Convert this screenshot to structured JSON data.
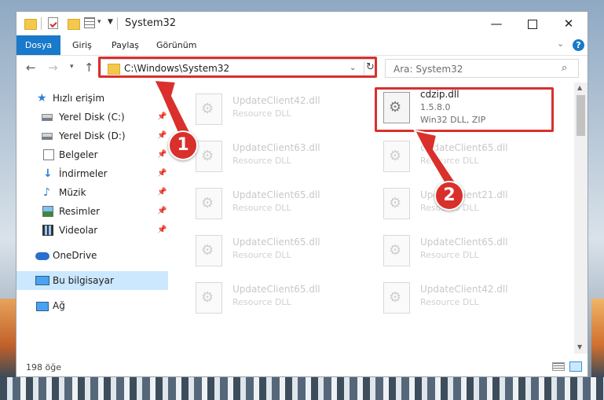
{
  "window": {
    "title": "System32",
    "minimize": "—",
    "close": "✕"
  },
  "ribbon": {
    "tabs": [
      "Dosya",
      "Giriş",
      "Paylaş",
      "Görünüm"
    ],
    "help": "?"
  },
  "navbar": {
    "address": "C:\\Windows\\System32",
    "search_placeholder": "Ara: System32"
  },
  "sidebar": {
    "items": [
      {
        "label": "Hızlı erişim",
        "icon": "star-icon",
        "pinned": false
      },
      {
        "label": "Yerel Disk (C:)",
        "icon": "drive-icon",
        "pinned": true
      },
      {
        "label": "Yerel Disk (D:)",
        "icon": "drive-icon",
        "pinned": true
      },
      {
        "label": "Belgeler",
        "icon": "document-icon",
        "pinned": true
      },
      {
        "label": "İndirmeler",
        "icon": "download-icon",
        "pinned": true
      },
      {
        "label": "Müzik",
        "icon": "music-icon",
        "pinned": true
      },
      {
        "label": "Resimler",
        "icon": "pictures-icon",
        "pinned": true
      },
      {
        "label": "Videolar",
        "icon": "video-icon",
        "pinned": true
      },
      {
        "label": "OneDrive",
        "icon": "cloud-icon",
        "pinned": false
      },
      {
        "label": "Bu bilgisayar",
        "icon": "computer-icon",
        "pinned": false,
        "selected": true
      },
      {
        "label": "Ağ",
        "icon": "network-icon",
        "pinned": false
      }
    ]
  },
  "files": [
    {
      "name": "UpdateClient42.dll",
      "desc": "Resource DLL"
    },
    {
      "name": "cdzip.dll",
      "version": "1.5.8.0",
      "desc": "Win32 DLL, ZIP",
      "highlighted": true
    },
    {
      "name": "UpdateClient63.dll",
      "desc": "Resource DLL"
    },
    {
      "name": "UpdateClient65.dll",
      "desc": "Resource DLL"
    },
    {
      "name": "UpdateClient65.dll",
      "desc": "Resource DLL"
    },
    {
      "name": "UpdateClient21.dll",
      "desc": "Resource DLL"
    },
    {
      "name": "UpdateClient65.dll",
      "desc": "Resource DLL"
    },
    {
      "name": "UpdateClient65.dll",
      "desc": "Resource DLL"
    },
    {
      "name": "UpdateClient65.dll",
      "desc": "Resource DLL"
    },
    {
      "name": "UpdateClient42.dll",
      "desc": "Resource DLL"
    }
  ],
  "status": {
    "item_count": "198 öğe"
  },
  "annotations": {
    "step1": "1",
    "step2": "2",
    "highlight_color": "#d9302c"
  }
}
